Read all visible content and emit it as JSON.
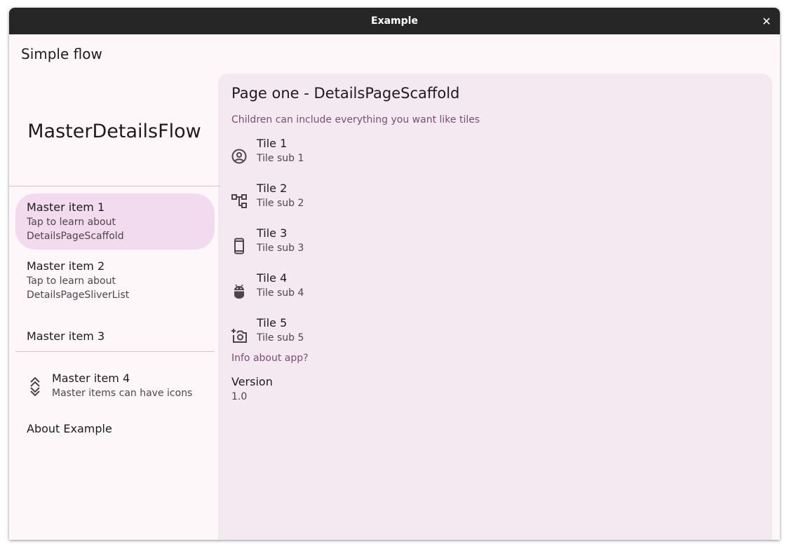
{
  "window": {
    "title": "Example"
  },
  "appbar": {
    "title": "Simple flow"
  },
  "sidebar": {
    "header": "MasterDetailsFlow",
    "items": [
      {
        "title": "Master item 1",
        "subtitle": "Tap to learn about DetailsPageScaffold",
        "selected": true
      },
      {
        "title": "Master item 2",
        "subtitle": "Tap to learn about DetailsPageSliverList",
        "selected": false
      },
      {
        "title": "Master item 3",
        "subtitle": "",
        "selected": false
      },
      {
        "title": "Master item 4",
        "subtitle": "Master items can have icons",
        "icon": "double-chevron-expand-icon",
        "selected": false
      },
      {
        "title": "About Example",
        "subtitle": "",
        "selected": false
      }
    ]
  },
  "details": {
    "title": "Page one - DetailsPageScaffold",
    "section_label": "Children can include everything you want like tiles",
    "tiles": [
      {
        "title": "Tile 1",
        "subtitle": "Tile sub 1",
        "icon": "account-circle-icon"
      },
      {
        "title": "Tile 2",
        "subtitle": "Tile sub 2",
        "icon": "account-tree-icon"
      },
      {
        "title": "Tile 3",
        "subtitle": "Tile sub 3",
        "icon": "smartphone-icon"
      },
      {
        "title": "Tile 4",
        "subtitle": "Tile sub 4",
        "icon": "android-icon"
      },
      {
        "title": "Tile 5",
        "subtitle": "Tile sub 5",
        "icon": "add-a-photo-icon"
      }
    ],
    "info_section_label": "Info about app?",
    "version": {
      "label": "Version",
      "value": "1.0"
    }
  },
  "colors": {
    "background": "#fdf7fa",
    "selected_item": "#f3dbef",
    "details_surface": "#f4e9f1",
    "section_label": "#7b4d74",
    "titlebar": "#262626"
  }
}
